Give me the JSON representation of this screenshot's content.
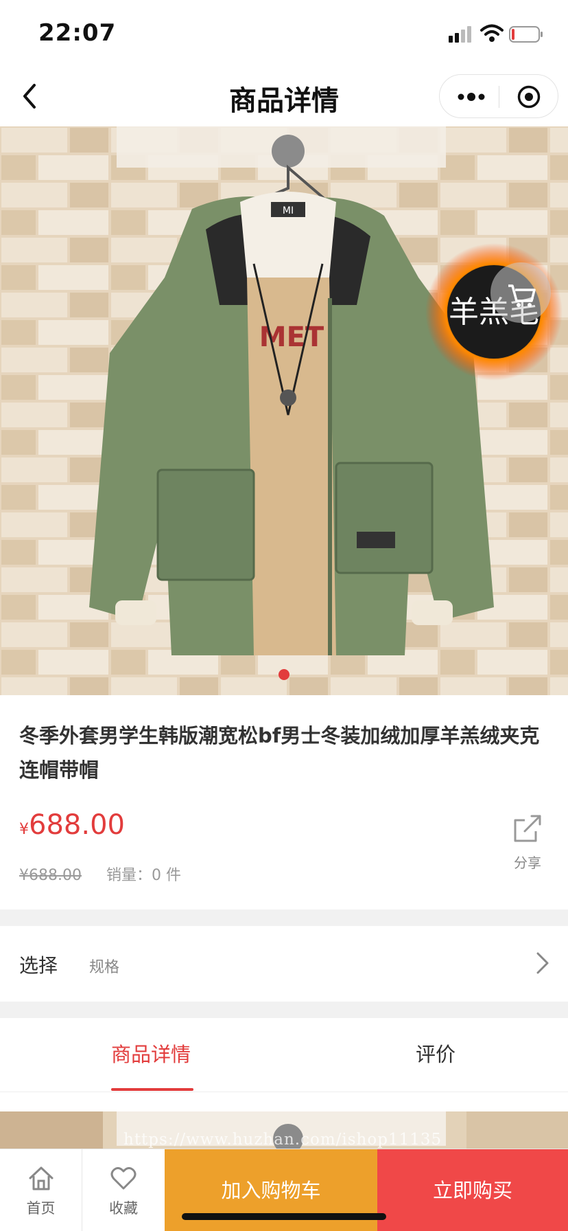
{
  "status_bar": {
    "time": "22:07"
  },
  "nav": {
    "title": "商品详情"
  },
  "product": {
    "title": "冬季外套男学生韩版潮宽松bf男士冬装加绒加厚羊羔绒夹克连帽带帽",
    "price_symbol": "¥",
    "price": "688.00",
    "original_price": "¥688.00",
    "sales": "销量：0 件",
    "image_badge_text": "羊羔毛",
    "image_tag_text": "MI",
    "shirt_print_text": "MET",
    "share_label": "分享"
  },
  "select": {
    "label": "选择",
    "value": "规格"
  },
  "tabs": [
    {
      "label": "商品详情",
      "active": true
    },
    {
      "label": "评价",
      "active": false
    }
  ],
  "watermark": "https://www.huzhan.com/ishop11135",
  "bottom_bar": {
    "home_label": "首页",
    "fav_label": "收藏",
    "cart_button": "加入购物车",
    "buy_button": "立即购买"
  },
  "colors": {
    "accent": "#e23c3c",
    "cart_button": "#eda02b",
    "buy_button": "#f04848"
  }
}
